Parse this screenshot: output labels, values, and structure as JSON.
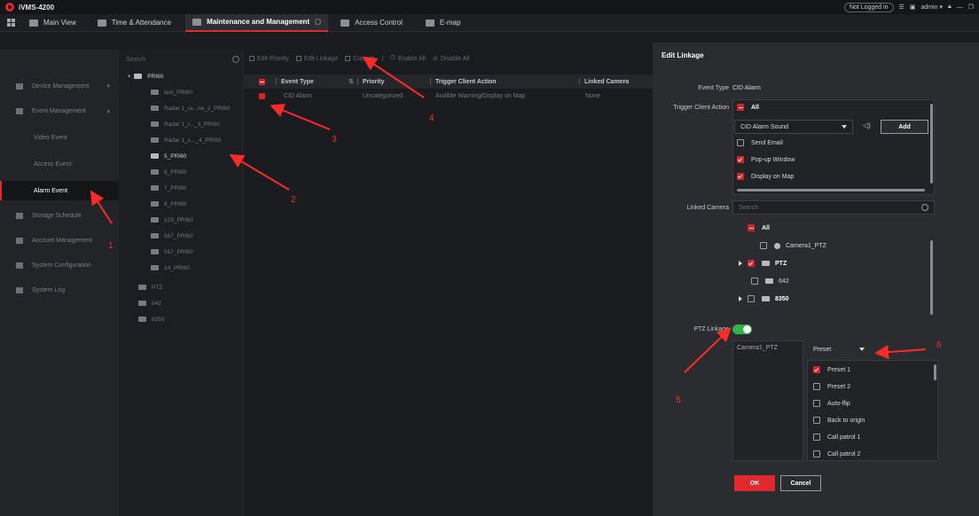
{
  "app": {
    "title": "iVMS-4200"
  },
  "titlebar": {
    "not_logged_in": "Not Logged in",
    "user": "admin"
  },
  "tabs": [
    {
      "label": "Main View"
    },
    {
      "label": "Time & Attendance"
    },
    {
      "label": "Maintenance and Management"
    },
    {
      "label": "Access Control"
    },
    {
      "label": "E-map"
    }
  ],
  "nav": {
    "items": [
      {
        "label": "Device Management"
      },
      {
        "label": "Event Management"
      },
      {
        "label": "Video Event"
      },
      {
        "label": "Access Event"
      },
      {
        "label": "Alarm Event"
      },
      {
        "label": "Storage Schedule"
      },
      {
        "label": "Account Management"
      },
      {
        "label": "System Configuration"
      },
      {
        "label": "System Log"
      }
    ]
  },
  "tree": {
    "search_placeholder": "Search",
    "items": [
      {
        "label": "PRI60"
      },
      {
        "label": "test_PRI60"
      },
      {
        "label": "Radar 1_ra...ne_2_PRI60"
      },
      {
        "label": "Radar 1_r..._3_PRI60"
      },
      {
        "label": "Radar 1_c..._4_PRI60"
      },
      {
        "label": "5_PRI60"
      },
      {
        "label": "6_PRI60"
      },
      {
        "label": "7_PRI60"
      },
      {
        "label": "8_PRI60"
      },
      {
        "label": "123_PRI60"
      },
      {
        "label": "567_PRI60"
      },
      {
        "label": "567_PRI60"
      },
      {
        "label": "14_PRI60"
      },
      {
        "label": "PTZ"
      },
      {
        "label": "642"
      },
      {
        "label": "8350"
      }
    ]
  },
  "toolbar": {
    "edit_priority": "Edit Priority",
    "edit_linkage": "Edit Linkage",
    "copy_to": "Copy to",
    "enable_all": "Enable All",
    "disable_all": "Disable All"
  },
  "table": {
    "headers": [
      "Event Type",
      "Priority",
      "Trigger Client Action",
      "Linked Camera"
    ],
    "rows": [
      [
        "CID Alarm",
        "Uncategorized",
        "Audible Warning/Display on Map",
        "None"
      ]
    ]
  },
  "edit_linkage": {
    "title": "Edit Linkage",
    "event_type_label": "Event Type",
    "event_type_value": "CID Alarm",
    "trigger_label": "Trigger Client Action",
    "all": "All",
    "sound_select": "CID Alarm Sound",
    "add_button": "Add",
    "send_email": "Send Email",
    "popup_window": "Pop-up Window",
    "display_on_map": "Display on Map",
    "linked_camera_label": "Linked Camera",
    "camera_search_placeholder": "Search",
    "camera_all": "All",
    "camera1": "Camera1_PTZ",
    "group_ptz": "PTZ",
    "group_642": "642",
    "group_8350": "8350",
    "ptz_linkage_label": "PTZ Linkage",
    "ptz_camera": "Camera1_PTZ",
    "preset_select": "Preset",
    "presets": [
      "Preset 1",
      "Preset 2",
      "Auto-flip",
      "Back to origin",
      "Call patrol 1",
      "Call patrol 2"
    ],
    "ok": "OK",
    "cancel": "Cancel"
  },
  "annotations": [
    "1",
    "2",
    "3",
    "4",
    "5",
    "6"
  ],
  "colors": {
    "accent": "#e0282f",
    "toggle_on": "#2fb34a",
    "annotation": "#ff2a2a"
  }
}
